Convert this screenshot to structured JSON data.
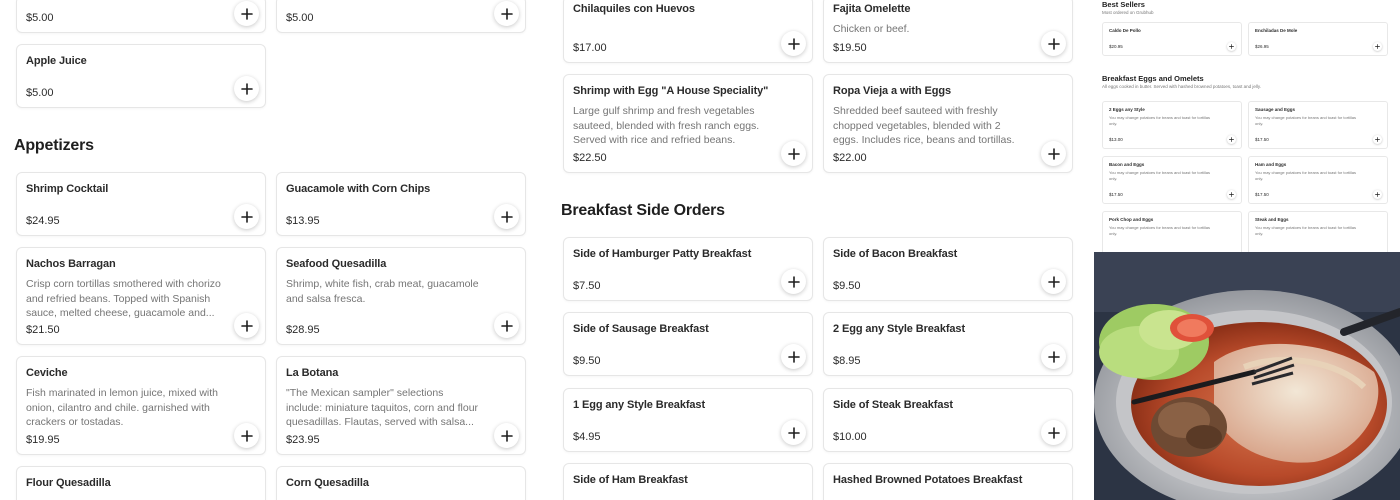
{
  "col1_top": [
    {
      "name": "",
      "price": "$5.00"
    },
    {
      "name": "",
      "price": "$5.00"
    },
    {
      "name": "Apple Juice",
      "price": "$5.00"
    }
  ],
  "appetizers": {
    "title": "Appetizers",
    "items": [
      {
        "name": "Shrimp Cocktail",
        "desc": "",
        "price": "$24.95"
      },
      {
        "name": "Guacamole with Corn Chips",
        "desc": "",
        "price": "$13.95"
      },
      {
        "name": "Nachos Barragan",
        "desc": "Crisp corn tortillas smothered with chorizo and refried beans. Topped with Spanish sauce, melted cheese, guacamole and...",
        "price": "$21.50"
      },
      {
        "name": "Seafood Quesadilla",
        "desc": "Shrimp, white fish, crab meat, guacamole and salsa fresca.",
        "price": "$28.95"
      },
      {
        "name": "Ceviche",
        "desc": "Fish marinated in lemon juice, mixed with onion, cilantro and chile. garnished with crackers or tostadas.",
        "price": "$19.95"
      },
      {
        "name": "La Botana",
        "desc": "\"The Mexican sampler\" selections include: miniature taquitos, corn and flour quesadillas. Flautas, served with salsa...",
        "price": "$23.95"
      },
      {
        "name": "Flour Quesadilla",
        "desc": "",
        "price": ""
      },
      {
        "name": "Corn Quesadilla",
        "desc": "",
        "price": ""
      }
    ]
  },
  "col2_top": [
    {
      "name": "Chilaquiles con Huevos",
      "desc": "",
      "price": "$17.00"
    },
    {
      "name": "Fajita Omelette",
      "desc": "Chicken or beef.",
      "price": "$19.50"
    },
    {
      "name": "Shrimp with Egg \"A House Speciality\"",
      "desc": "Large gulf shrimp and fresh vegetables sauteed, blended with fresh ranch eggs. Served with rice and refried beans.",
      "price": "$22.50"
    },
    {
      "name": "Ropa Vieja a with Eggs",
      "desc": "Shredded beef sauteed with freshly chopped vegetables, blended with 2 eggs. Includes rice, beans and tortillas.",
      "price": "$22.00"
    }
  ],
  "breakfast_sides": {
    "title": "Breakfast Side Orders",
    "items": [
      {
        "name": "Side of Hamburger Patty Breakfast",
        "price": "$7.50"
      },
      {
        "name": "Side of Bacon Breakfast",
        "price": "$9.50"
      },
      {
        "name": "Side of Sausage Breakfast",
        "price": "$9.50"
      },
      {
        "name": "2 Egg any Style Breakfast",
        "price": "$8.95"
      },
      {
        "name": "1 Egg any Style Breakfast",
        "price": "$4.95"
      },
      {
        "name": "Side of Steak Breakfast",
        "price": "$10.00"
      },
      {
        "name": "Side of Ham Breakfast",
        "price": ""
      },
      {
        "name": "Hashed Browned Potatoes Breakfast",
        "price": ""
      }
    ]
  },
  "panel": {
    "best_sellers_title": "Best Sellers",
    "best_sellers_sub": "Most ordered on Grubhub",
    "best_sellers": [
      {
        "name": "Caldo De Pollo",
        "price": "$20.95"
      },
      {
        "name": "Enchiladas De Mole",
        "price": "$26.95"
      }
    ],
    "breakfast_title": "Breakfast Eggs and Omelets",
    "breakfast_sub": "All eggs cooked in butter. Served with hashed browned potatoes, toast and jelly.",
    "items": [
      {
        "name": "2 Eggs any Style",
        "desc": "You may change potatoes for beans and toast for tortillas only.",
        "price": "$13.00"
      },
      {
        "name": "Sausage and Eggs",
        "desc": "You may change potatoes for beans and toast for tortillas only.",
        "price": "$17.50"
      },
      {
        "name": "Bacon and Eggs",
        "desc": "You may change potatoes for beans and toast for tortillas only.",
        "price": "$17.50"
      },
      {
        "name": "Ham and Eggs",
        "desc": "You may change potatoes for beans and toast for tortillas only.",
        "price": "$17.50"
      },
      {
        "name": "Pork Chop and Eggs",
        "desc": "You may change potatoes for beans and toast for tortillas only.",
        "price": ""
      },
      {
        "name": "Steak and Eggs",
        "desc": "You may change potatoes for beans and toast for tortillas only.",
        "price": ""
      }
    ]
  },
  "colors": {
    "text": "#1f1f1f",
    "muted": "#757575",
    "border": "#e6e6e6"
  }
}
